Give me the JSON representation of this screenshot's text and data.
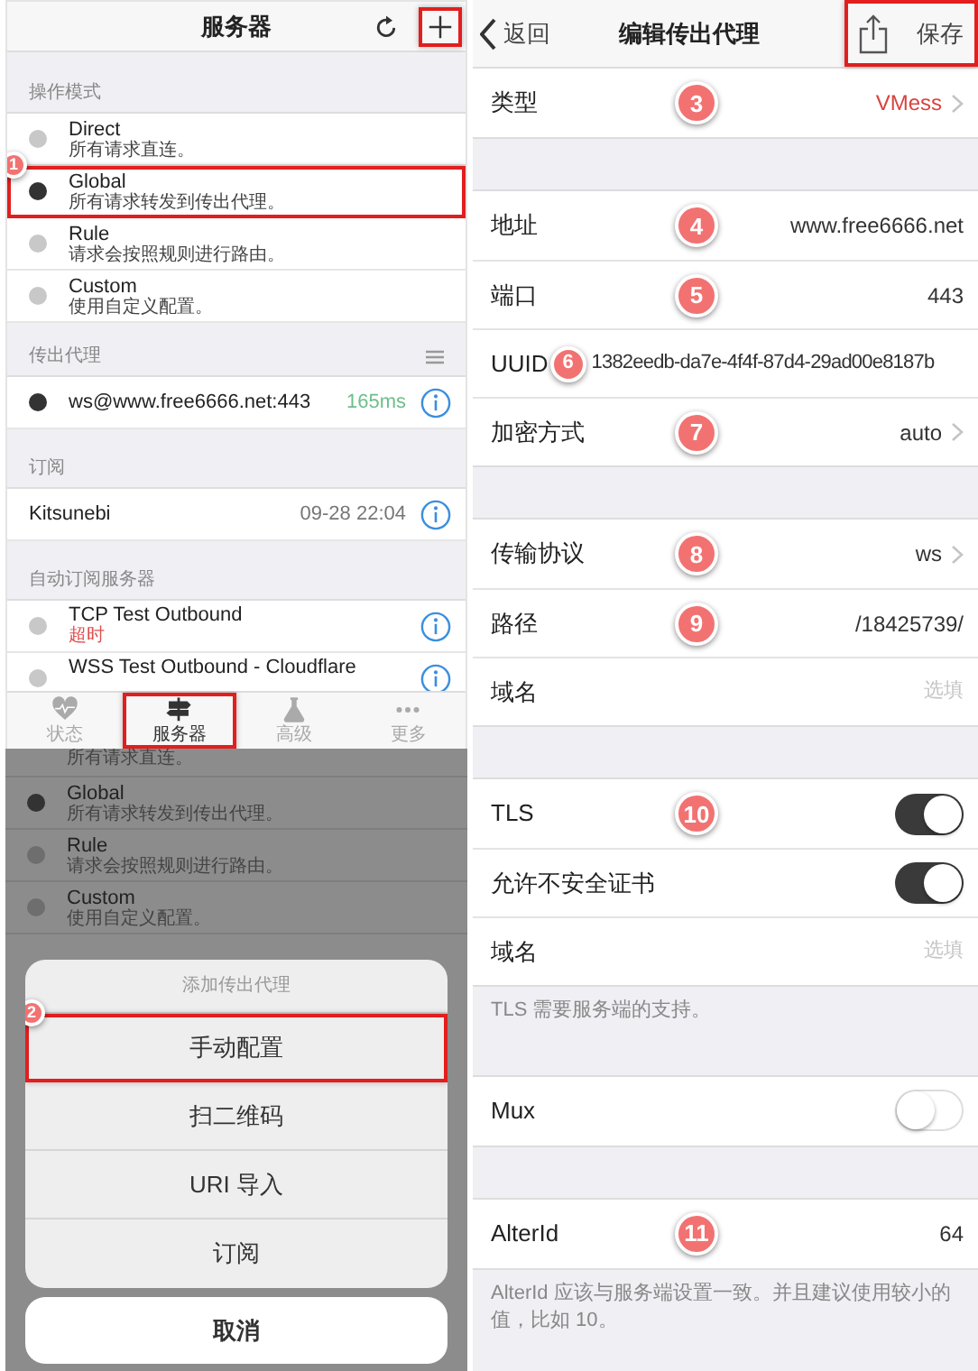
{
  "server_screen": {
    "title": "服务器",
    "nav_buttons": [
      {
        "kind": "refresh",
        "highlighted": false
      },
      {
        "kind": "add",
        "highlighted": true
      }
    ],
    "mode_header": "操作模式",
    "modes": [
      {
        "name": "Direct",
        "description": "所有请求直连。",
        "selected": false,
        "highlighted": false
      },
      {
        "name": "Global",
        "description": "所有请求转发到传出代理。",
        "selected": true,
        "highlighted": true,
        "callout": "1"
      },
      {
        "name": "Rule",
        "description": "请求会按照规则进行路由。",
        "selected": false,
        "highlighted": false
      },
      {
        "name": "Custom",
        "description": "使用自定义配置。",
        "selected": false,
        "highlighted": false
      }
    ],
    "outbound_header": "传出代理",
    "outbounds": [
      {
        "address": "ws@www.free6666.net:443",
        "latency": "165ms",
        "selected": true
      }
    ],
    "subscription_header": "订阅",
    "subscriptions": [
      {
        "name": "Kitsunebi",
        "updated": "09-28 22:04"
      }
    ],
    "auto_header": "自动订阅服务器",
    "auto_servers": [
      {
        "name": "TCP Test Outbound",
        "status": "超时",
        "selected": false
      },
      {
        "name": "WSS Test Outbound - Cloudflare",
        "selected": false
      }
    ],
    "tabs": [
      {
        "label": "状态",
        "selected": false,
        "highlighted": false
      },
      {
        "label": "服务器",
        "selected": true,
        "highlighted": true
      },
      {
        "label": "高级",
        "selected": false,
        "highlighted": false
      },
      {
        "label": "更多",
        "selected": false,
        "highlighted": false
      }
    ]
  },
  "sheet_screen": {
    "background_modes": [
      {
        "description": "所有请求直连。"
      },
      {
        "name": "Global",
        "description": "所有请求转发到传出代理。",
        "selected": true
      },
      {
        "name": "Rule",
        "description": "请求会按照规则进行路由。",
        "selected": false
      },
      {
        "name": "Custom",
        "description": "使用自定义配置。",
        "selected": false
      }
    ],
    "sheet_title": "添加传出代理",
    "options": [
      {
        "label": "手动配置",
        "highlighted": true,
        "callout": "2"
      },
      {
        "label": "扫二维码",
        "highlighted": false
      },
      {
        "label": "URI 导入",
        "highlighted": false
      },
      {
        "label": "订阅",
        "highlighted": false
      }
    ],
    "cancel": "取消"
  },
  "edit_screen": {
    "back": "返回",
    "title": "编辑传出代理",
    "save": "保存",
    "save_highlighted": true,
    "groups": [
      {
        "rows": [
          {
            "kind": "select",
            "label": "类型",
            "value": "VMess",
            "color": "#d9433f",
            "callout": "3"
          }
        ]
      },
      {
        "rows": [
          {
            "kind": "text",
            "label": "地址",
            "value": "www.free6666.net",
            "callout": "4"
          },
          {
            "kind": "text",
            "label": "端口",
            "value": "443",
            "callout": "5"
          },
          {
            "kind": "text",
            "label": "UUID",
            "value": "1382eedb-da7e-4f4f-87d4-29ad00e8187b",
            "callout": "6",
            "callout_inline": true
          },
          {
            "kind": "select",
            "label": "加密方式",
            "value": "auto",
            "callout": "7"
          }
        ]
      },
      {
        "rows": [
          {
            "kind": "select",
            "label": "传输协议",
            "value": "ws",
            "callout": "8"
          },
          {
            "kind": "text",
            "label": "路径",
            "value": "/18425739/",
            "callout": "9"
          },
          {
            "kind": "input",
            "label": "域名",
            "placeholder": "选填"
          }
        ]
      },
      {
        "rows": [
          {
            "kind": "switch",
            "label": "TLS",
            "on": true,
            "callout": "10"
          },
          {
            "kind": "switch",
            "label": "允许不安全证书",
            "on": true
          },
          {
            "kind": "input",
            "label": "域名",
            "placeholder": "选填"
          }
        ],
        "footer": "TLS 需要服务端的支持。"
      },
      {
        "rows": [
          {
            "kind": "switch",
            "label": "Mux",
            "on": false
          }
        ]
      },
      {
        "rows": [
          {
            "kind": "text",
            "label": "AlterId",
            "value": "64",
            "callout": "11"
          }
        ],
        "footer": "AlterId 应该与服务端设置一致。并且建议使用较小的值，比如 10。"
      }
    ]
  }
}
